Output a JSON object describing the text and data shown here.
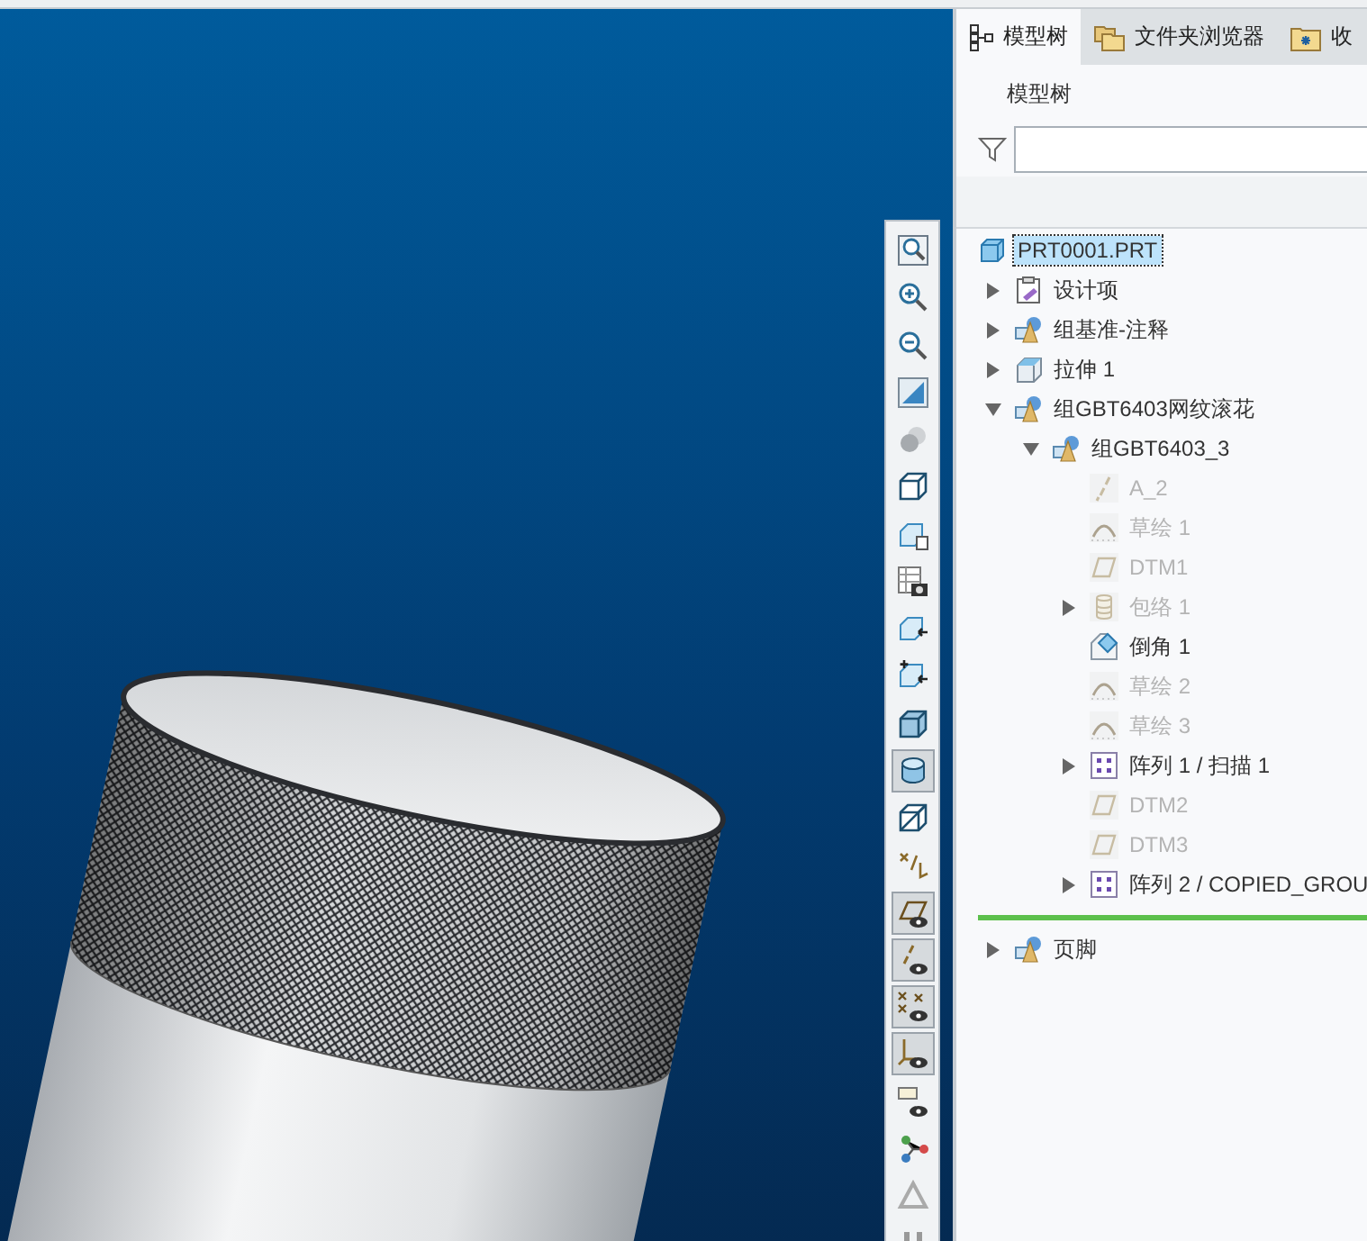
{
  "tabs": [
    {
      "label": "模型树",
      "kind": "tree",
      "selected": true
    },
    {
      "label": "文件夹浏览器",
      "kind": "folders",
      "selected": false
    },
    {
      "label": "收",
      "kind": "favorites",
      "selected": false
    }
  ],
  "panel_title": "模型树",
  "toolbar": [
    {
      "kind": "zoom-fit",
      "on": false
    },
    {
      "kind": "zoom-in",
      "on": false
    },
    {
      "kind": "zoom-out",
      "on": false
    },
    {
      "kind": "repaint",
      "on": false
    },
    {
      "kind": "spheres",
      "on": false
    },
    {
      "kind": "cube",
      "on": false
    },
    {
      "kind": "cube-doc",
      "on": false
    },
    {
      "kind": "table-camera",
      "on": false
    },
    {
      "kind": "cube-arrow",
      "on": false
    },
    {
      "kind": "cube-plus",
      "on": false
    },
    {
      "kind": "glass-cube",
      "on": false
    },
    {
      "kind": "cylinder",
      "on": true
    },
    {
      "kind": "cube-slash",
      "on": false
    },
    {
      "kind": "points",
      "on": false
    },
    {
      "kind": "plane-eye",
      "on": true
    },
    {
      "kind": "axis-eye",
      "on": true
    },
    {
      "kind": "point-eye",
      "on": true
    },
    {
      "kind": "csys-eye",
      "on": true
    },
    {
      "kind": "note-eye",
      "on": false
    },
    {
      "kind": "nodes",
      "on": false
    },
    {
      "kind": "triangle",
      "on": false
    },
    {
      "kind": "bars",
      "on": false
    }
  ],
  "tree": {
    "root": {
      "label": "PRT0001.PRT",
      "kind": "part",
      "selected": true,
      "children": [
        {
          "label": "设计项",
          "kind": "design-items",
          "selected": false,
          "suppressed": false,
          "expanded": false
        },
        {
          "label": "组基准-注释",
          "kind": "group",
          "selected": false,
          "suppressed": false,
          "expanded": false
        },
        {
          "label": "拉伸 1",
          "kind": "extrude",
          "selected": false,
          "suppressed": false,
          "expanded": false
        },
        {
          "label": "组GBT6403网纹滚花",
          "kind": "group",
          "selected": false,
          "suppressed": false,
          "expanded": true,
          "children": [
            {
              "label": "组GBT6403_3",
              "kind": "group",
              "selected": false,
              "suppressed": false,
              "expanded": true,
              "children": [
                {
                  "label": "A_2",
                  "kind": "axis",
                  "selected": false,
                  "suppressed": true
                },
                {
                  "label": "草绘 1",
                  "kind": "sketch",
                  "selected": false,
                  "suppressed": true
                },
                {
                  "label": "DTM1",
                  "kind": "plane",
                  "selected": false,
                  "suppressed": true
                },
                {
                  "label": "包络 1",
                  "kind": "envelope",
                  "selected": false,
                  "suppressed": true,
                  "expanded": false
                },
                {
                  "label": "倒角 1",
                  "kind": "chamfer",
                  "selected": false,
                  "suppressed": false
                },
                {
                  "label": "草绘 2",
                  "kind": "sketch",
                  "selected": false,
                  "suppressed": true
                },
                {
                  "label": "草绘 3",
                  "kind": "sketch",
                  "selected": false,
                  "suppressed": true
                },
                {
                  "label": "阵列 1 / 扫描 1",
                  "kind": "pattern",
                  "selected": false,
                  "suppressed": false,
                  "expanded": false
                },
                {
                  "label": "DTM2",
                  "kind": "plane",
                  "selected": false,
                  "suppressed": true
                },
                {
                  "label": "DTM3",
                  "kind": "plane",
                  "selected": false,
                  "suppressed": true
                },
                {
                  "label": "阵列 2 / COPIED_GROU",
                  "kind": "pattern",
                  "selected": false,
                  "suppressed": false,
                  "expanded": false
                }
              ]
            }
          ]
        },
        {
          "label": "页脚",
          "kind": "group",
          "selected": false,
          "suppressed": false,
          "expanded": false,
          "insert_marker_above": true
        }
      ]
    }
  }
}
